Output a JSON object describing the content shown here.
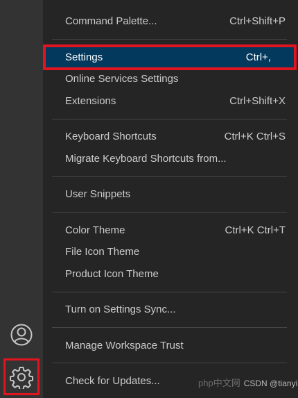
{
  "activity_bar": {
    "accounts_icon": "account-icon",
    "manage_icon": "gear-icon"
  },
  "menu": {
    "items": [
      {
        "label": "Command Palette...",
        "keybinding": "Ctrl+Shift+P"
      },
      {
        "label": "Settings",
        "keybinding": "Ctrl+,"
      },
      {
        "label": "Online Services Settings",
        "keybinding": ""
      },
      {
        "label": "Extensions",
        "keybinding": "Ctrl+Shift+X"
      },
      {
        "label": "Keyboard Shortcuts",
        "keybinding": "Ctrl+K Ctrl+S"
      },
      {
        "label": "Migrate Keyboard Shortcuts from...",
        "keybinding": ""
      },
      {
        "label": "User Snippets",
        "keybinding": ""
      },
      {
        "label": "Color Theme",
        "keybinding": "Ctrl+K Ctrl+T"
      },
      {
        "label": "File Icon Theme",
        "keybinding": ""
      },
      {
        "label": "Product Icon Theme",
        "keybinding": ""
      },
      {
        "label": "Turn on Settings Sync...",
        "keybinding": ""
      },
      {
        "label": "Manage Workspace Trust",
        "keybinding": ""
      },
      {
        "label": "Check for Updates...",
        "keybinding": ""
      }
    ]
  },
  "watermark": {
    "logo_text": "php中文网",
    "text": "CSDN @tianyiHon"
  },
  "colors": {
    "highlight": "#e0151f",
    "selected_bg": "#04395e"
  }
}
